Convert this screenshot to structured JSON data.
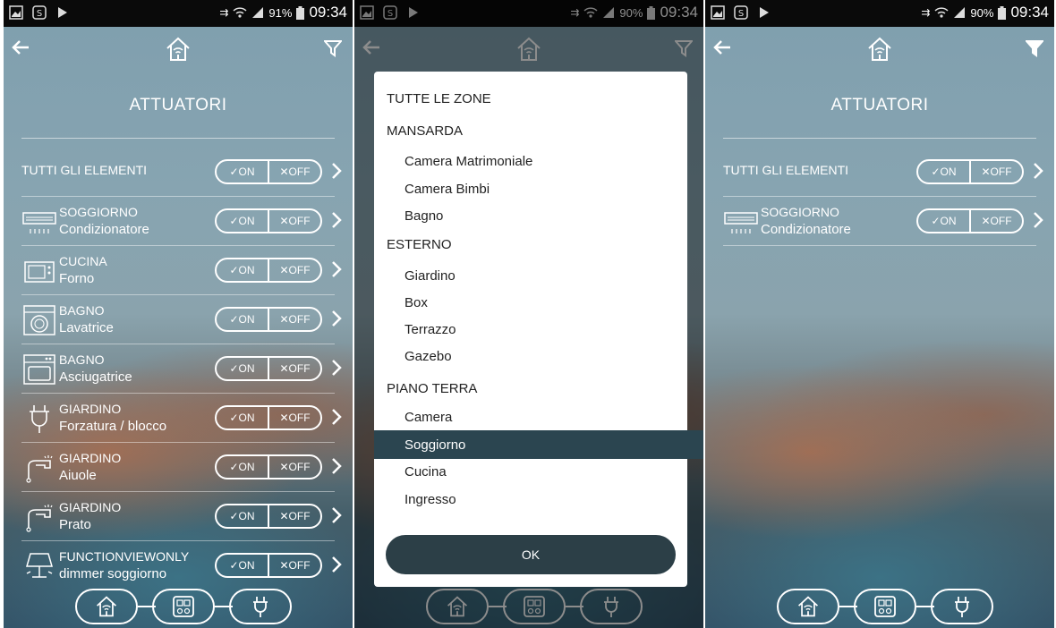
{
  "status_left": [
    "gallery-icon",
    "s-app-icon",
    "play-store-icon"
  ],
  "screens": [
    {
      "battery": "91%",
      "time": "09:34"
    },
    {
      "battery": "90%",
      "time": "09:34"
    },
    {
      "battery": "90%",
      "time": "09:34"
    }
  ],
  "title": "ATTUATORI",
  "all_label": "TUTTI GLI ELEMENTI",
  "toggle": {
    "on": "✓ON",
    "off": "✕OFF"
  },
  "rows": [
    {
      "zone": "SOGGIORNO",
      "device": "Condizionatore",
      "icon": "air-conditioner-icon"
    },
    {
      "zone": "CUCINA",
      "device": "Forno",
      "icon": "oven-icon"
    },
    {
      "zone": "BAGNO",
      "device": "Lavatrice",
      "icon": "washing-machine-icon"
    },
    {
      "zone": "BAGNO",
      "device": "Asciugatrice",
      "icon": "dryer-icon"
    },
    {
      "zone": "GIARDINO",
      "device": "Forzatura / blocco",
      "icon": "plug-icon"
    },
    {
      "zone": "GIARDINO",
      "device": "Aiuole",
      "icon": "sprinkler-icon"
    },
    {
      "zone": "GIARDINO",
      "device": "Prato",
      "icon": "sprinkler-icon"
    },
    {
      "zone": "FUNCTIONVIEWONLY",
      "device": "dimmer soggiorno",
      "icon": "lamp-icon"
    }
  ],
  "filter_dialog": {
    "items": [
      {
        "label": "TUTTE LE ZONE",
        "kind": "group"
      },
      {
        "label": "MANSARDA",
        "kind": "group"
      },
      {
        "label": "Camera Matrimoniale",
        "kind": "zone"
      },
      {
        "label": "Camera Bimbi",
        "kind": "zone"
      },
      {
        "label": "Bagno",
        "kind": "zone"
      },
      {
        "label": "ESTERNO",
        "kind": "group"
      },
      {
        "label": "Giardino",
        "kind": "zone"
      },
      {
        "label": "Box",
        "kind": "zone"
      },
      {
        "label": "Terrazzo",
        "kind": "zone"
      },
      {
        "label": "Gazebo",
        "kind": "zone"
      },
      {
        "label": "PIANO TERRA",
        "kind": "group"
      },
      {
        "label": "Camera",
        "kind": "zone"
      },
      {
        "label": "Soggiorno",
        "kind": "zone",
        "selected": true
      },
      {
        "label": "Cucina",
        "kind": "zone"
      },
      {
        "label": "Ingresso",
        "kind": "zone"
      }
    ],
    "ok_label": "OK"
  },
  "nav_icons": [
    "home-wifi-icon",
    "panel-icon",
    "plug-icon"
  ],
  "colors": {
    "dialog_selected": "#2b4550",
    "ok_button": "#2c3f47",
    "statusbar": "#0a0a0a"
  }
}
